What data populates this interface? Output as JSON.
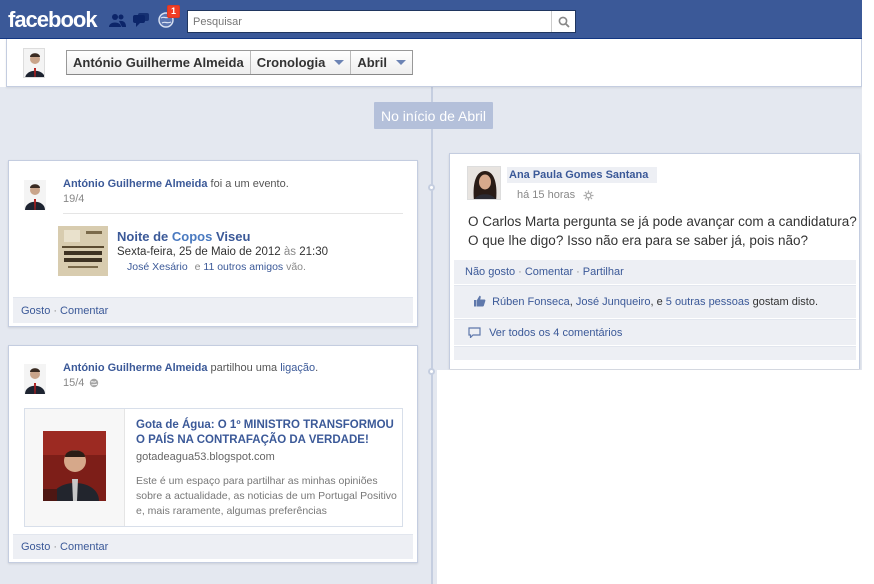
{
  "topbar": {
    "logo": "facebook",
    "notification_count": "1",
    "search_placeholder": "Pesquisar"
  },
  "timeline_header": {
    "name": "António Guilherme Almeida",
    "section": "Cronologia",
    "month": "Abril"
  },
  "month_marker": "No início de Abril",
  "event_story": {
    "author": "António Guilherme Almeida",
    "action": "foi a um evento.",
    "date": "19/4",
    "event_title_a": "Noite de ",
    "event_title_b": "Copos",
    "event_title_c": " Viseu",
    "event_time_a": "Sexta-feira, 25 de Maio de 2012",
    "event_time_b": " às ",
    "event_time_c": "21:30",
    "attendee": "José Xesário",
    "attendee_and": "e",
    "others": "11 outros amigos",
    "others_suffix": " vão.",
    "poster_lines": [
      "FADOS DE COIMBRA",
      "FADOS DE LISBOA"
    ],
    "actions": {
      "like": "Gosto",
      "sep": "·",
      "comment": "Comentar"
    }
  },
  "link_story": {
    "author": "António Guilherme Almeida",
    "action_a": "partilhou uma ",
    "action_b": "ligação",
    "action_c": ".",
    "date": "15/4",
    "share": {
      "title": "Gota de Água: O 1º MINISTRO TRANSFORMOU O PAÍS NA CONTRAFAÇÃO DA VERDADE!",
      "url": "gotadeagua53.blogspot.com",
      "description": "Este é um espaço para partilhar as minhas opiniões sobre a actualidade, as noticias de um Portugal Positivo e, mais raramente, algumas preferências"
    },
    "actions": {
      "like": "Gosto",
      "sep": "·",
      "comment": "Comentar"
    }
  },
  "post": {
    "author": "Ana Paula Gomes Santana",
    "time": "há 15 horas",
    "message": "O Carlos Marta pergunta se já pode avançar com a candidatura? O que lhe digo? Isso não era para se saber já, pois não?",
    "actions": {
      "unlike": "Não gosto",
      "comment": "Comentar",
      "share": "Partilhar",
      "sep": "·"
    },
    "likes": {
      "person1": "Rúben Fonseca",
      "comma": ", ",
      "person2": "José Junqueiro",
      "and": ", e ",
      "others": "5 outras pessoas",
      "suffix": " gostam disto."
    },
    "view_comments": "Ver todos os 4 comentários"
  },
  "colors": {
    "brand": "#3b5998",
    "badge": "#f03d25",
    "timeline_bg": "#e4e8f0",
    "month_pill": "#b4c0da"
  }
}
